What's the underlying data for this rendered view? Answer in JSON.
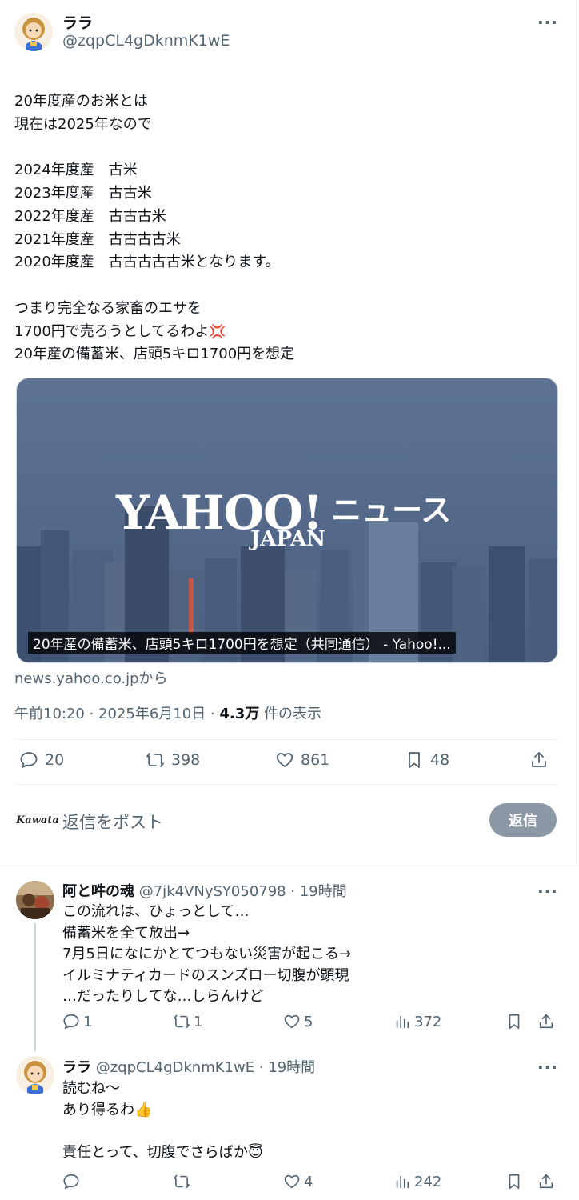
{
  "main_post": {
    "author_name": "ララ",
    "author_handle": "@zqpCL4gDknmK1wE",
    "more_label": "···",
    "text": "20年度産のお米とは\n現在は2025年なので\n\n2024年度産　古米\n2023年度産　古古米\n2022年度産　古古古米\n2021年度産　古古古古米\n2020年度産　古古古古古米となります。\n\nつまり完全なる家畜のエサを\n1700円で売ろうとしてるわよ",
    "text_end_emoji": "💢",
    "text_tail": "20年産の備蓄米、店頭5キロ1700円を想定",
    "card": {
      "logo_main": "YAHOO!",
      "logo_sub": "JAPAN",
      "logo_kana": "ニュース",
      "caption": "20年産の備蓄米、店頭5キロ1700円を想定（共同通信） - Yahoo!...",
      "source": "news.yahoo.co.jpから"
    },
    "meta": {
      "time": "午前10:20 · 2025年6月10日 · ",
      "views_count": "4.3万",
      "views_label": " 件の表示"
    },
    "actions": {
      "replies": "20",
      "reposts": "398",
      "likes": "861",
      "bookmarks": "48"
    }
  },
  "reply_composer": {
    "avatar_text": "Kawata",
    "placeholder": "返信をポスト",
    "button_label": "返信"
  },
  "replies": [
    {
      "author_name": "阿と吽の魂",
      "author_handle": "@7jk4VNySY050798",
      "time": "· 19時間",
      "text": "この流れは、ひょっとして…\n備蓄米を全て放出→\n7月5日になにかとてつもない災害が起こる→\nイルミナティカードのスンズロー切腹が顕現\n…だったりしてな…しらんけど",
      "replies": "1",
      "reposts": "1",
      "likes": "5",
      "views": "372"
    },
    {
      "author_name": "ララ",
      "author_handle": "@zqpCL4gDknmK1wE",
      "time": "· 19時間",
      "text_line1": "読むね〜",
      "text_line2": "あり得るわ",
      "emoji2": "👍",
      "text_line3": "責任とって、切腹でさらばか",
      "emoji3": "😇",
      "replies": "",
      "reposts": "",
      "likes": "4",
      "views": "242"
    }
  ],
  "colors": {
    "text": "#0f1419",
    "secondary": "#536471",
    "divider": "#eff3f4",
    "reply_button": "#8b98a5"
  }
}
